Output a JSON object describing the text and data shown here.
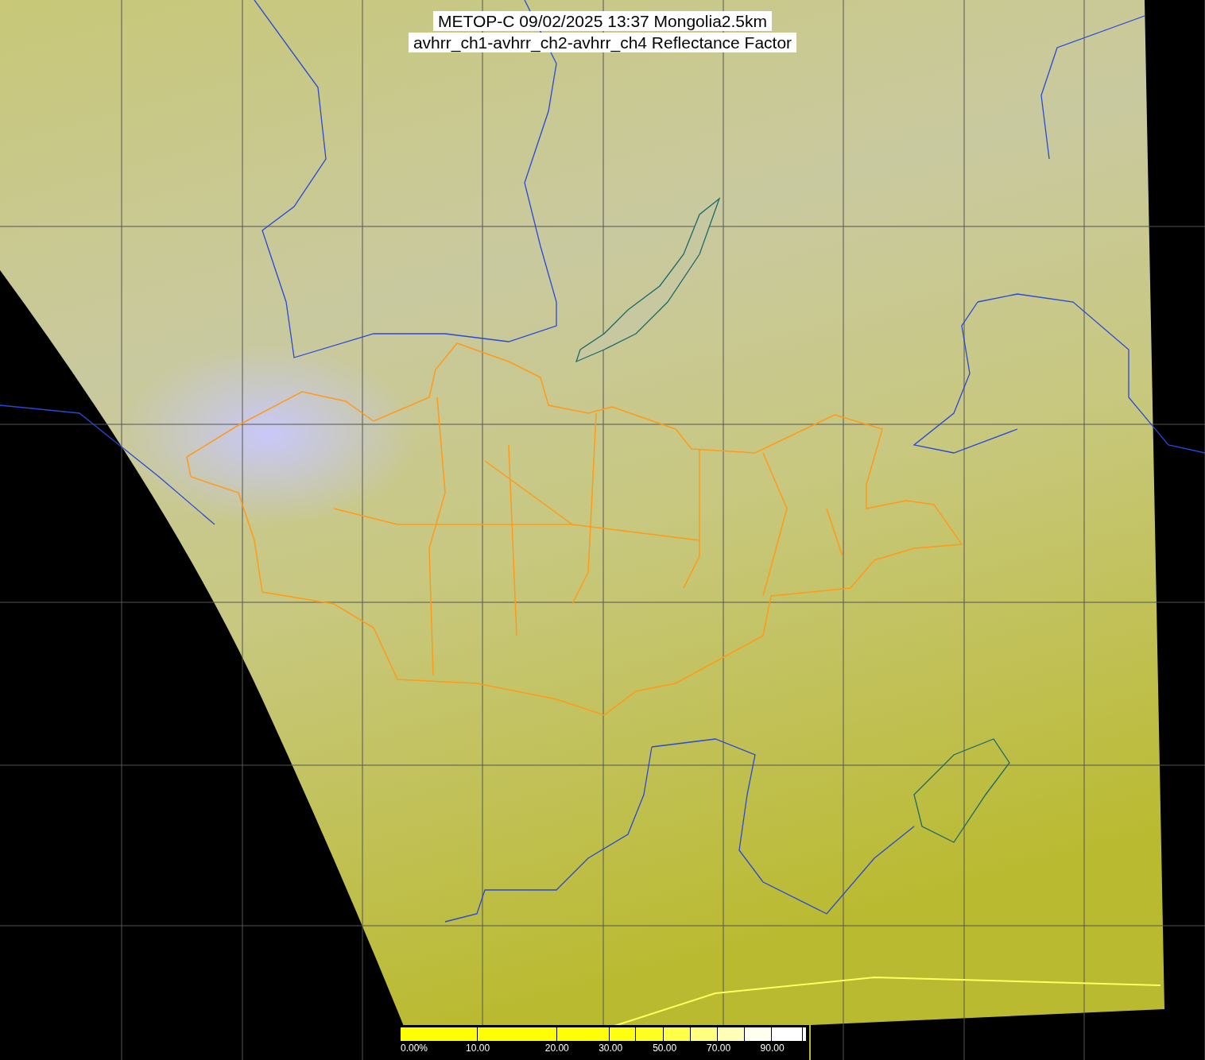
{
  "title": {
    "lines": [
      "METOP-C 09/02/2025 13:37 Mongolia2.5km",
      "avhrr_ch1-avhrr_ch2-avhrr_ch4 Reflectance Factor"
    ]
  },
  "colorbar": {
    "segments": [
      {
        "color": "#ffff00"
      },
      {
        "color": "#ffff00"
      },
      {
        "color": "#ffff04"
      },
      {
        "color": "#ffff10"
      },
      {
        "color": "#ffff20"
      },
      {
        "color": "#ffff48"
      },
      {
        "color": "#ffff80"
      },
      {
        "color": "#ffffb8"
      },
      {
        "color": "#fffff0"
      },
      {
        "color": "#ffffff"
      },
      {
        "color": "#ffffff"
      }
    ],
    "labels": [
      "0.00%",
      "10.00",
      "20.00",
      "30.00",
      "50.00",
      "70.00",
      "90.00"
    ]
  }
}
